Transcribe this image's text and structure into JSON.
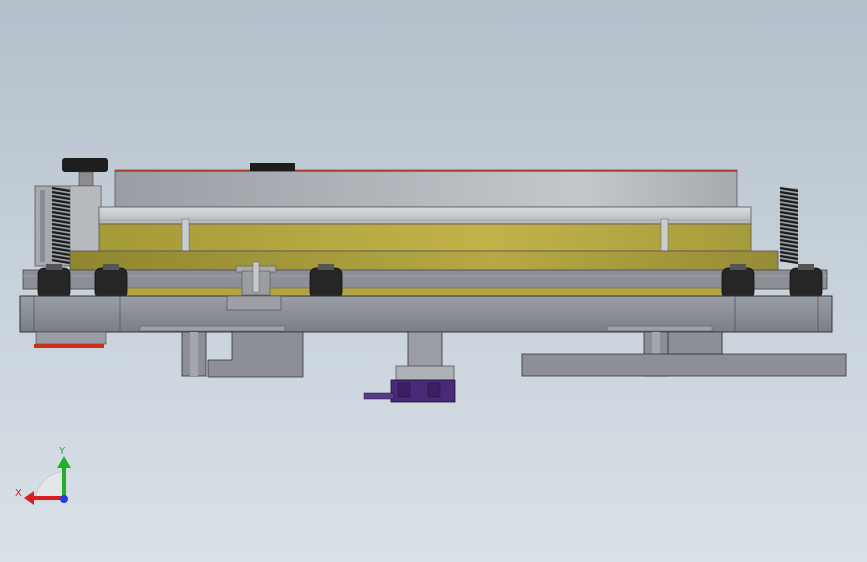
{
  "triad": {
    "x_label": "X",
    "y_label": "Y",
    "x_color": "#d62020",
    "y_color": "#22b02a",
    "z_color": "#2040e0"
  },
  "colors": {
    "background_top": "#b3bfca",
    "background_bottom": "#d9e1e8",
    "frame_gray": "#8b8e96",
    "gold_plate": "#b8a940",
    "red_edge": "#c8321e",
    "purple_block": "#4a2a78",
    "roller_black": "#2a2a2a",
    "spring_black": "#222222"
  },
  "icons": {
    "triad": "coordinate-triad-icon",
    "knob": "black-knob",
    "spring": "coil-spring"
  }
}
